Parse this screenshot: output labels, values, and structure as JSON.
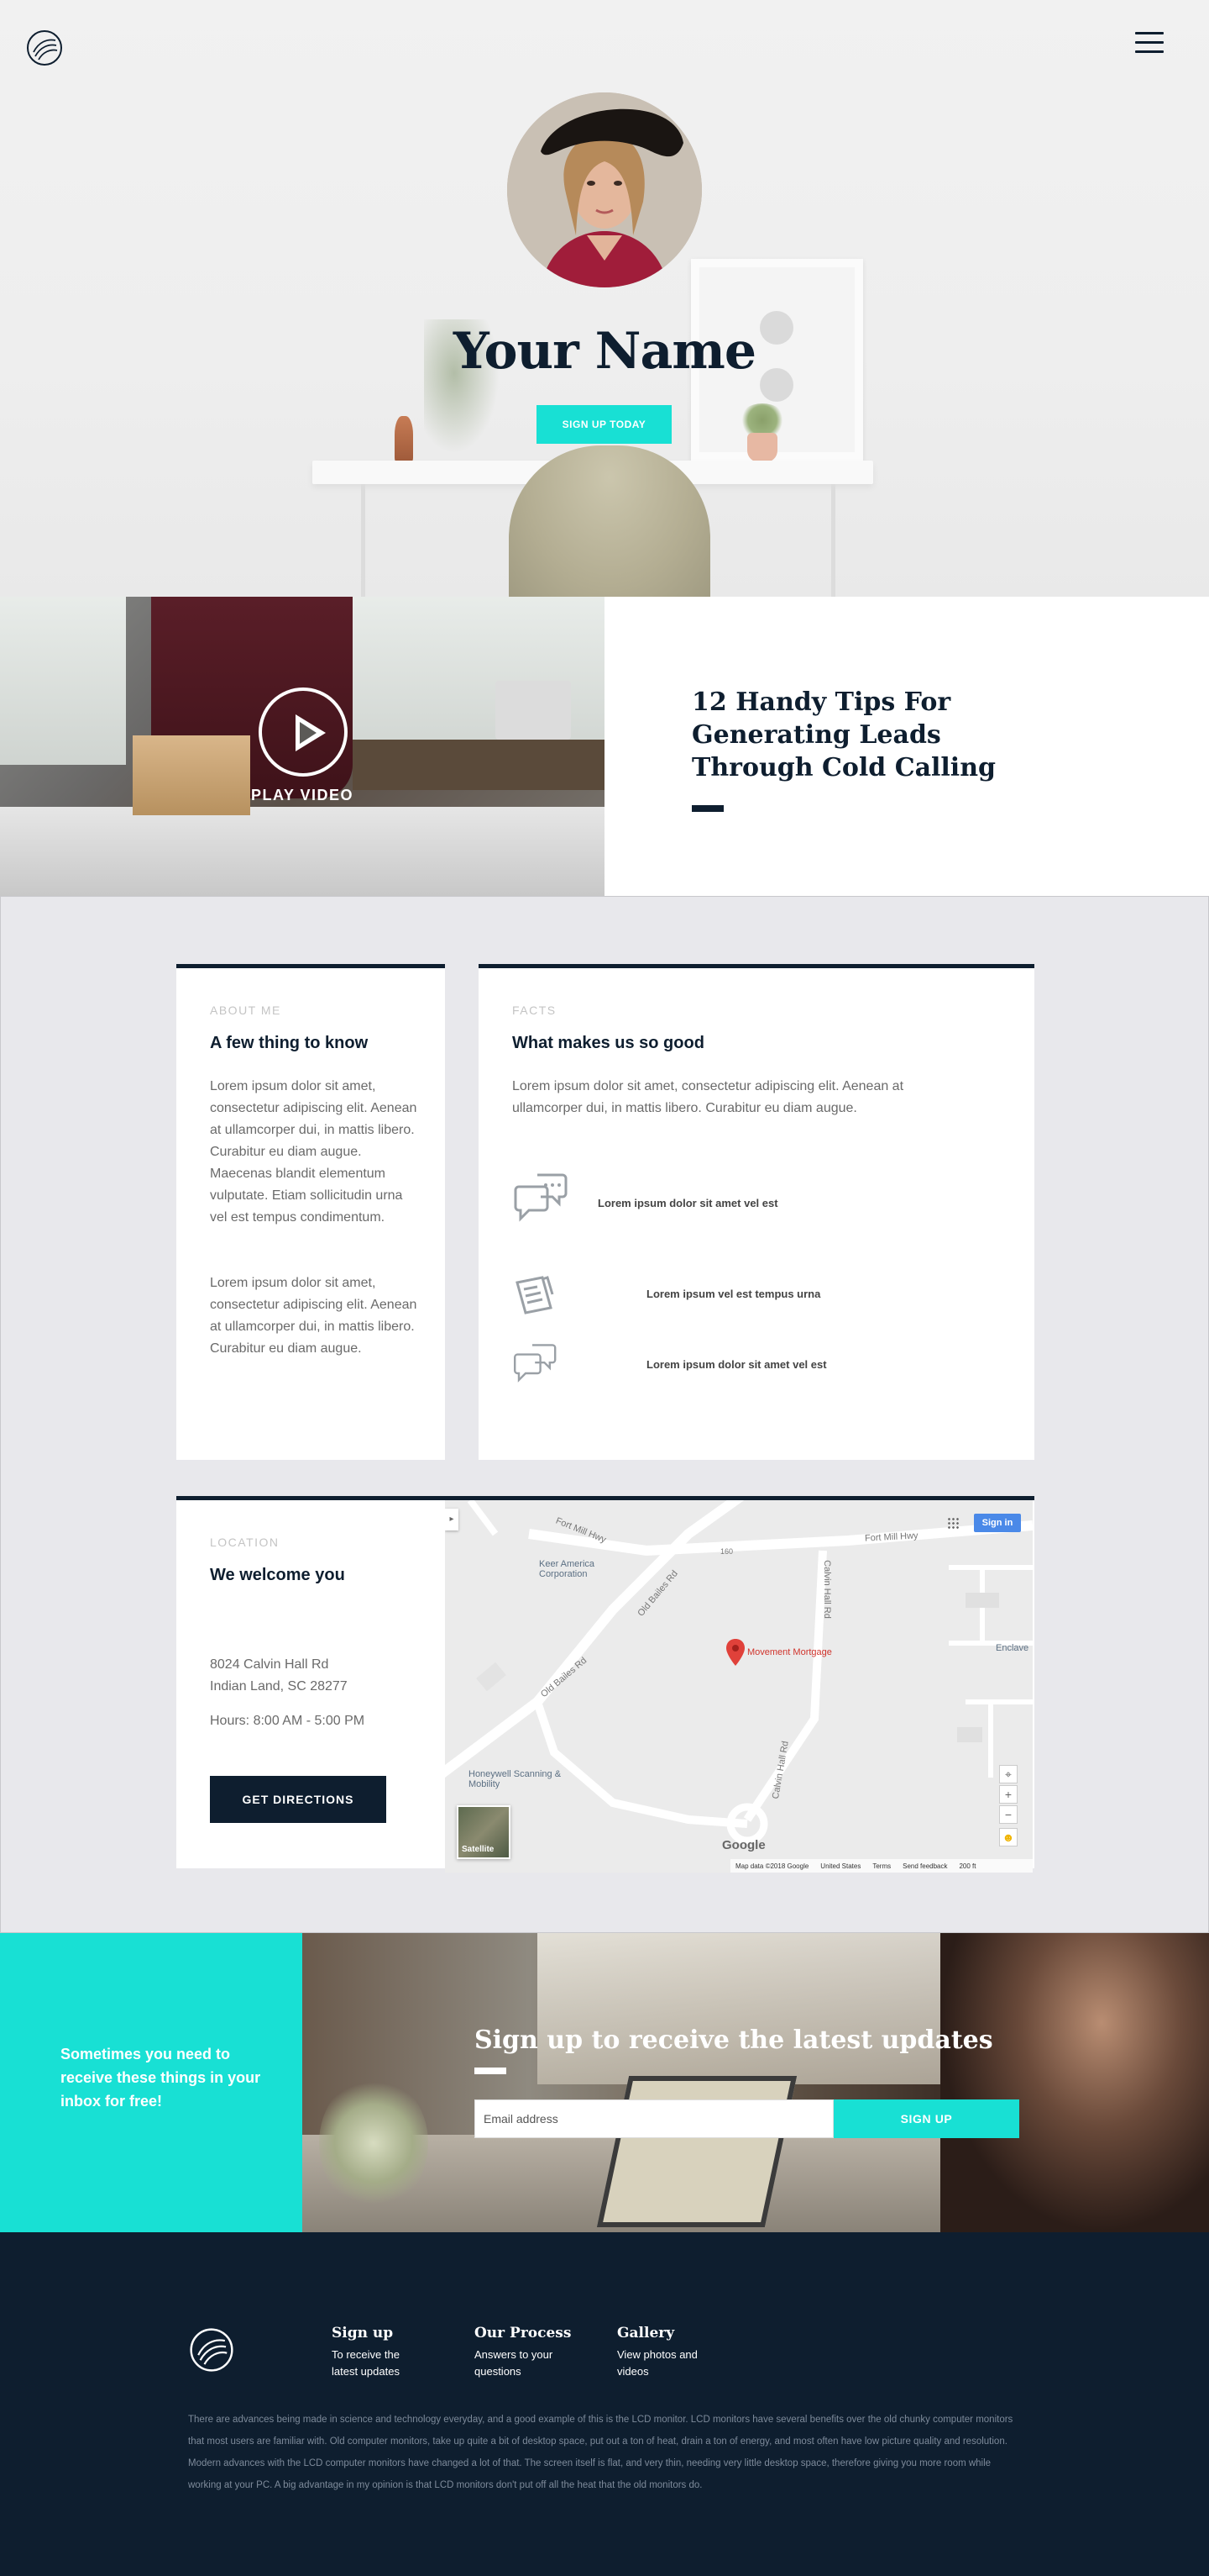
{
  "hero": {
    "title": "Your Name",
    "cta_label": "SIGN UP TODAY"
  },
  "video": {
    "play_label": "PLAY VIDEO"
  },
  "article": {
    "title": "12 Handy Tips For Generating Leads Through Cold Calling"
  },
  "about": {
    "eyebrow": "ABOUT ME",
    "heading": "A few thing to know",
    "paragraph_1": "Lorem ipsum dolor sit amet, consectetur adipiscing elit. Aenean at ullamcorper dui, in mattis libero. Curabitur eu diam augue. Maecenas blandit elementum vulputate. Etiam sollicitudin urna vel est tempus condimentum.",
    "paragraph_2": "Lorem ipsum dolor sit amet, consectetur adipiscing elit. Aenean at ullamcorper dui, in mattis libero. Curabitur eu diam augue."
  },
  "facts": {
    "eyebrow": "FACTS",
    "heading": "What makes us so good",
    "intro": "Lorem ipsum dolor sit amet, consectetur adipiscing elit. Aenean at ullamcorper dui, in mattis libero. Curabitur eu diam augue.",
    "items": [
      {
        "icon": "chat-bubbles-icon",
        "label": "Lorem ipsum dolor sit amet vel est"
      },
      {
        "icon": "clipboard-icon",
        "label": "Lorem ipsum vel est tempus urna"
      },
      {
        "icon": "chat-bubbles-icon",
        "label": "Lorem ipsum dolor sit amet vel est"
      }
    ]
  },
  "location": {
    "eyebrow": "LOCATION",
    "heading": "We welcome you",
    "address_line_1": "8024 Calvin Hall Rd",
    "address_line_2": "Indian Land, SC 28277",
    "hours": "Hours: 8:00 AM - 5:00 PM",
    "button_label": "GET DIRECTIONS"
  },
  "map": {
    "sign_in": "Sign in",
    "marker_label": "Movement Mortgage",
    "poi_1": "Keer America Corporation",
    "poi_2": "Honeywell Scanning & Mobility",
    "poi_3": "Enclave",
    "road_1": "Fort Mill Hwy",
    "road_2": "Old Bailes Rd",
    "road_3": "Calvin Hall Rd",
    "road_4": "Old Bailes Rd",
    "road_5": "Calvin Hall Rd",
    "road_6": "160",
    "satellite": "Satellite",
    "google": "Google",
    "map_data": "Map data ©2018 Google",
    "country": "United States",
    "terms": "Terms",
    "feedback": "Send feedback",
    "scale": "200 ft",
    "zoom_in": "+",
    "zoom_out": "−"
  },
  "signup": {
    "side_text": "Sometimes you need to receive these things in your inbox for free!",
    "heading": "Sign up to receive the latest updates",
    "email_placeholder": "Email address",
    "button_label": "SIGN UP"
  },
  "footer": {
    "columns": [
      {
        "title": "Sign up",
        "text": "To receive the latest updates"
      },
      {
        "title": "Our Process",
        "text": "Answers to your questions"
      },
      {
        "title": "Gallery",
        "text": "View photos and videos"
      }
    ],
    "legal": "There are advances being made in science and technology everyday, and a good example of this is the LCD monitor. LCD monitors have several benefits over the old chunky computer monitors that most users are familiar with. Old computer monitors, take up quite a bit of desktop space, put out a ton of heat, drain a ton of energy, and most often have low picture quality and resolution. Modern advances with the LCD computer monitors have changed a lot of that. The screen itself is flat, and very thin, needing very little desktop space, therefore giving you more room while working at your PC. A big advantage in my opinion is that LCD monitors don't put off all the heat that the old monitors do."
  },
  "colors": {
    "accent": "#18e0d4",
    "navy": "#0e1e2f",
    "map_sign_in": "#4a89e8",
    "marker": "#e0413a"
  }
}
